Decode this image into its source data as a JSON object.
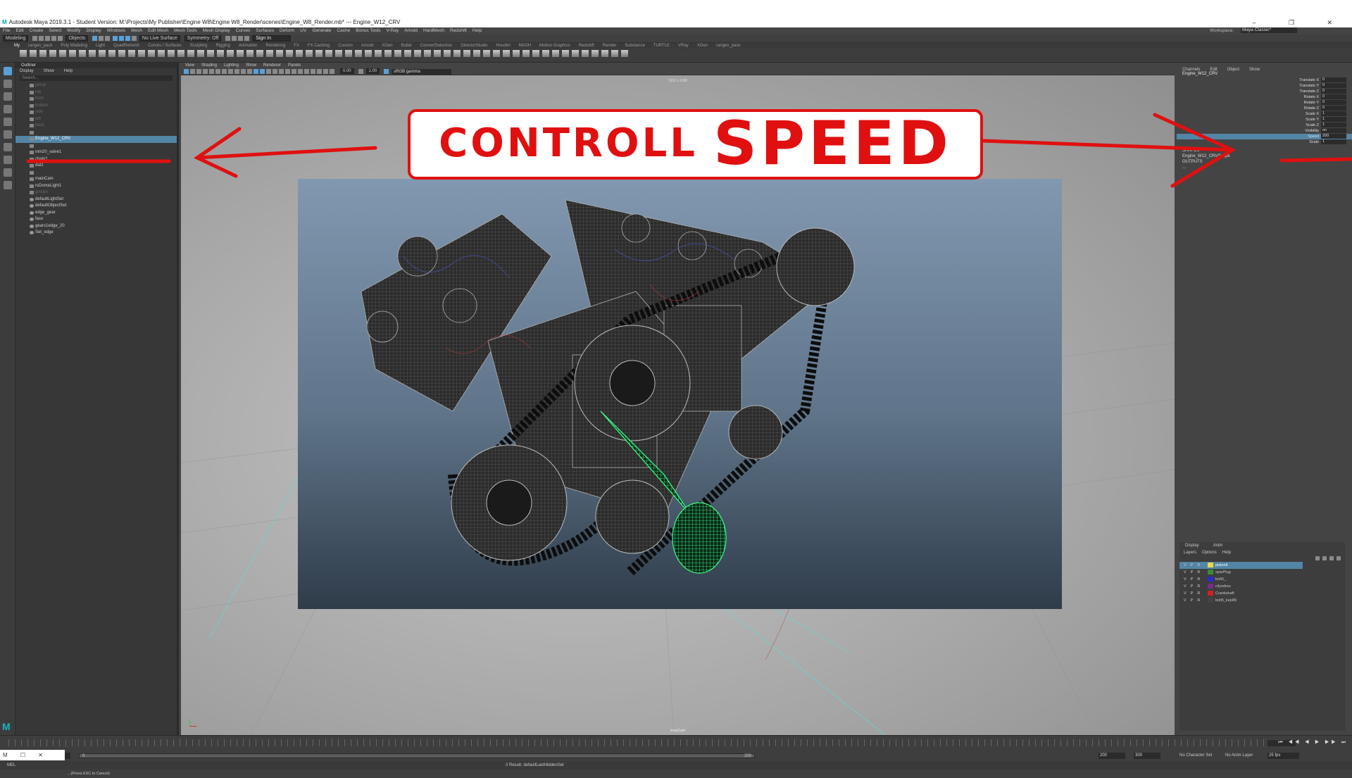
{
  "app": {
    "title": "Autodesk Maya 2019.3.1 - Student Version: M:\\Projects\\My Publisher\\Engine W8\\Engine W8_Render\\scenes\\Engine_W8_Render.mb*  ---  Engine_W12_CRV",
    "window_controls": "– ❐ ✕"
  },
  "menubar": {
    "items": [
      "File",
      "Edit",
      "Create",
      "Select",
      "Modify",
      "Display",
      "Windows",
      "Mesh",
      "Edit Mesh",
      "Mesh Tools",
      "Mesh Display",
      "Curves",
      "Surfaces",
      "Deform",
      "UV",
      "Generate",
      "Cache",
      "Bonus Tools",
      "V-Ray",
      "Arnold",
      "HardMesh",
      "Redshift",
      "Help"
    ],
    "workspace_label": "Workspace:",
    "workspace_value": "Maya Classic*"
  },
  "statusline": {
    "mode": "Modeling",
    "selection_mode": "Objects",
    "live_surface": "No Live Surface",
    "symmetry": "Symmetry: Off",
    "sign_in": "Sign In"
  },
  "shelf": {
    "tabs": [
      "My",
      "ranges_pack",
      "Poly Modeling",
      "Light",
      "QuadRemesh",
      "Curves / Surfaces",
      "Sculpting",
      "Rigging",
      "Animation",
      "Rendering",
      "FX",
      "FX Caching",
      "Custom",
      "Arnold",
      "XGen",
      "Bullet",
      "ConvertSelection",
      "DirectorStudio",
      "Houdini",
      "MASH",
      "Motion Graphics",
      "Redshift",
      "Render",
      "Substance",
      "TURTLE",
      "VRay",
      "XGen",
      "ranges_pack"
    ],
    "active_tab": "My"
  },
  "outliner": {
    "title": "Outliner",
    "menu": [
      "Display",
      "Show",
      "Help"
    ],
    "search_placeholder": "Search...",
    "items": [
      {
        "label": "persp",
        "dim": true
      },
      {
        "label": "top",
        "dim": true
      },
      {
        "label": "front",
        "dim": true
      },
      {
        "label": "bottom",
        "dim": true
      },
      {
        "label": "side",
        "dim": true
      },
      {
        "label": "left",
        "dim": true
      },
      {
        "label": "back",
        "dim": true
      },
      {
        "label": "",
        "dim": true
      },
      {
        "label": "Engine_W12_CRV",
        "selected": true
      },
      {
        "label": ""
      },
      {
        "label": "mm20_valve1"
      },
      {
        "label": "chain1"
      },
      {
        "label": "dat1"
      },
      {
        "label": ""
      },
      {
        "label": "mainCam"
      },
      {
        "label": "rsDomeLight1"
      },
      {
        "label": "groups",
        "dim": true
      },
      {
        "label": "defaultLightSet",
        "set": true
      },
      {
        "label": "defaultObjectSet",
        "set": true
      },
      {
        "label": "edge_gear",
        "set": true
      },
      {
        "label": "face",
        "set": true
      },
      {
        "label": "gears1edge_20",
        "set": true
      },
      {
        "label": "Set_edge",
        "set": true
      }
    ]
  },
  "viewport": {
    "menu": [
      "View",
      "Shading",
      "Lighting",
      "Show",
      "Renderer",
      "Panels"
    ],
    "exposure": "0.00",
    "gamma": "1.00",
    "color_space": "sRGB gamma",
    "resolution_gate": "1920 x 1080",
    "camera_name": "mainCam"
  },
  "annotation": {
    "text_small": "CONTROLL",
    "text_big": "SPEED",
    "color": "#e01010"
  },
  "channelbox": {
    "menu": [
      "Channels",
      "Edit",
      "Object",
      "Show"
    ],
    "object_name": "Engine_W12_CRV",
    "attributes": [
      {
        "name": "Translate X",
        "value": "0"
      },
      {
        "name": "Translate Y",
        "value": "0"
      },
      {
        "name": "Translate Z",
        "value": "0"
      },
      {
        "name": "Rotate X",
        "value": "0"
      },
      {
        "name": "Rotate Y",
        "value": "0"
      },
      {
        "name": "Rotate Z",
        "value": "0"
      },
      {
        "name": "Scale X",
        "value": "1"
      },
      {
        "name": "Scale Y",
        "value": "1"
      },
      {
        "name": "Scale Z",
        "value": "1"
      },
      {
        "name": "Visibility",
        "value": "on"
      },
      {
        "name": "Speed",
        "value": "200",
        "selected": true
      },
      {
        "name": "Scale",
        "value": "1"
      }
    ],
    "shapes_header": "SHAPES",
    "shape_name": "Engine_W12_CRVShape",
    "outputs_header": "OUTPUTS",
    "output_name": "..."
  },
  "layer_editor": {
    "tabs": [
      "Display",
      "Anim"
    ],
    "menu": [
      "Layers",
      "Options",
      "Help"
    ],
    "layers": [
      {
        "name": "piston5",
        "color": "#e8d84a",
        "selected": true
      },
      {
        "name": "sparPlug",
        "color": "#3a8a3a"
      },
      {
        "name": "bolt5_",
        "color": "#2a2ad0"
      },
      {
        "name": "cilyndres",
        "color": "#7a2a8a"
      },
      {
        "name": "Crankshaft",
        "color": "#d02020"
      },
      {
        "name": "bolt5_kep89",
        "color": "#444444"
      }
    ]
  },
  "timeline": {
    "range_start": "0",
    "range_inner_start": "0",
    "range_inner_label_left": "0",
    "range_inner_label_right": "200",
    "range_end": "200",
    "anim_end": "300",
    "character_set": "No Character Set",
    "anim_layer": "No Anim Layer",
    "fps": "25 fps",
    "playback": "⏮ ◀◀ ◀ ▶ ▶▶ ⏭"
  },
  "cmdline": {
    "language": "MEL",
    "result": "// Result: defaultLastHiddenSet"
  },
  "helpline": {
    "text": "...(Press ESC to Cancel)"
  }
}
